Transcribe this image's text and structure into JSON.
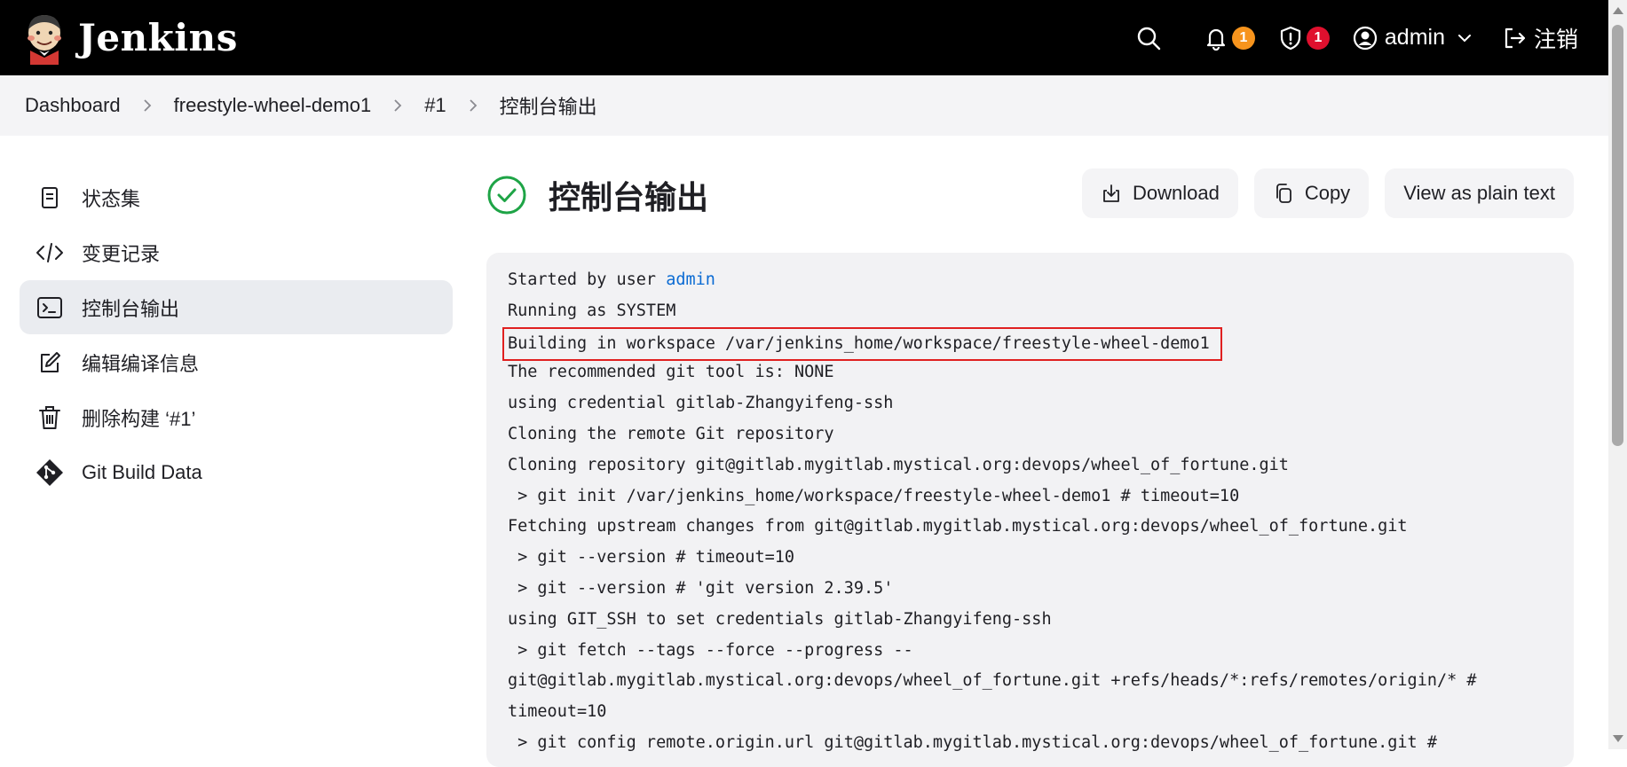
{
  "header": {
    "brand": "Jenkins",
    "notifications_count": "1",
    "security_count": "1",
    "user": "admin",
    "logout": "注销",
    "colors": {
      "notif_badge": "#f7941d",
      "security_badge": "#e0102e"
    }
  },
  "breadcrumb": [
    "Dashboard",
    "freestyle-wheel-demo1",
    "#1",
    "控制台输出"
  ],
  "sidebar": {
    "items": [
      {
        "label": "状态集",
        "icon": "document-icon"
      },
      {
        "label": "变更记录",
        "icon": "code-icon"
      },
      {
        "label": "控制台输出",
        "icon": "terminal-icon",
        "active": true
      },
      {
        "label": "编辑编译信息",
        "icon": "edit-icon"
      },
      {
        "label": "删除构建 ‘#1’",
        "icon": "trash-icon"
      },
      {
        "label": "Git Build Data",
        "icon": "git-icon"
      }
    ]
  },
  "main": {
    "title": "控制台输出",
    "buttons": {
      "download": "Download",
      "copy": "Copy",
      "plain": "View as plain text"
    }
  },
  "console": {
    "line0_prefix": "Started by user ",
    "line0_user": "admin",
    "lines": [
      "Running as SYSTEM",
      "Building in workspace /var/jenkins_home/workspace/freestyle-wheel-demo1",
      "The recommended git tool is: NONE",
      "using credential gitlab-Zhangyifeng-ssh",
      "Cloning the remote Git repository",
      "Cloning repository git@gitlab.mygitlab.mystical.org:devops/wheel_of_fortune.git",
      " > git init /var/jenkins_home/workspace/freestyle-wheel-demo1 # timeout=10",
      "Fetching upstream changes from git@gitlab.mygitlab.mystical.org:devops/wheel_of_fortune.git",
      " > git --version # timeout=10",
      " > git --version # 'git version 2.39.5'",
      "using GIT_SSH to set credentials gitlab-Zhangyifeng-ssh",
      " > git fetch --tags --force --progress --",
      "git@gitlab.mygitlab.mystical.org:devops/wheel_of_fortune.git +refs/heads/*:refs/remotes/origin/* #",
      "timeout=10",
      " > git config remote.origin.url git@gitlab.mygitlab.mystical.org:devops/wheel_of_fortune.git #"
    ]
  }
}
